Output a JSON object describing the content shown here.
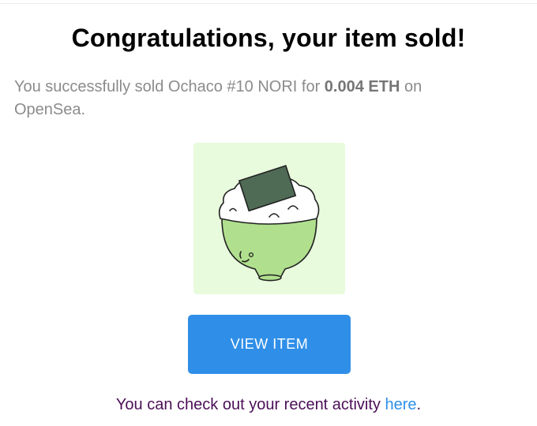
{
  "email": {
    "heading": "Congratulations, your item sold!",
    "message": {
      "prefix": "You successfully sold Ochaco #10 NORI for ",
      "price": "0.004 ETH",
      "suffix": " on OpenSea."
    },
    "item_image": {
      "icon": "rice-bowl-with-nori-icon",
      "background_color": "#e8fbdc",
      "bowl_color": "#b0e08e"
    },
    "view_button_label": "VIEW ITEM",
    "footer": {
      "text": "You can check out your recent activity ",
      "link_label": "here",
      "end": "."
    }
  },
  "colors": {
    "button": "#2f8fe8",
    "footer_text": "#4b0f57",
    "message_text": "#8b8b8b"
  }
}
